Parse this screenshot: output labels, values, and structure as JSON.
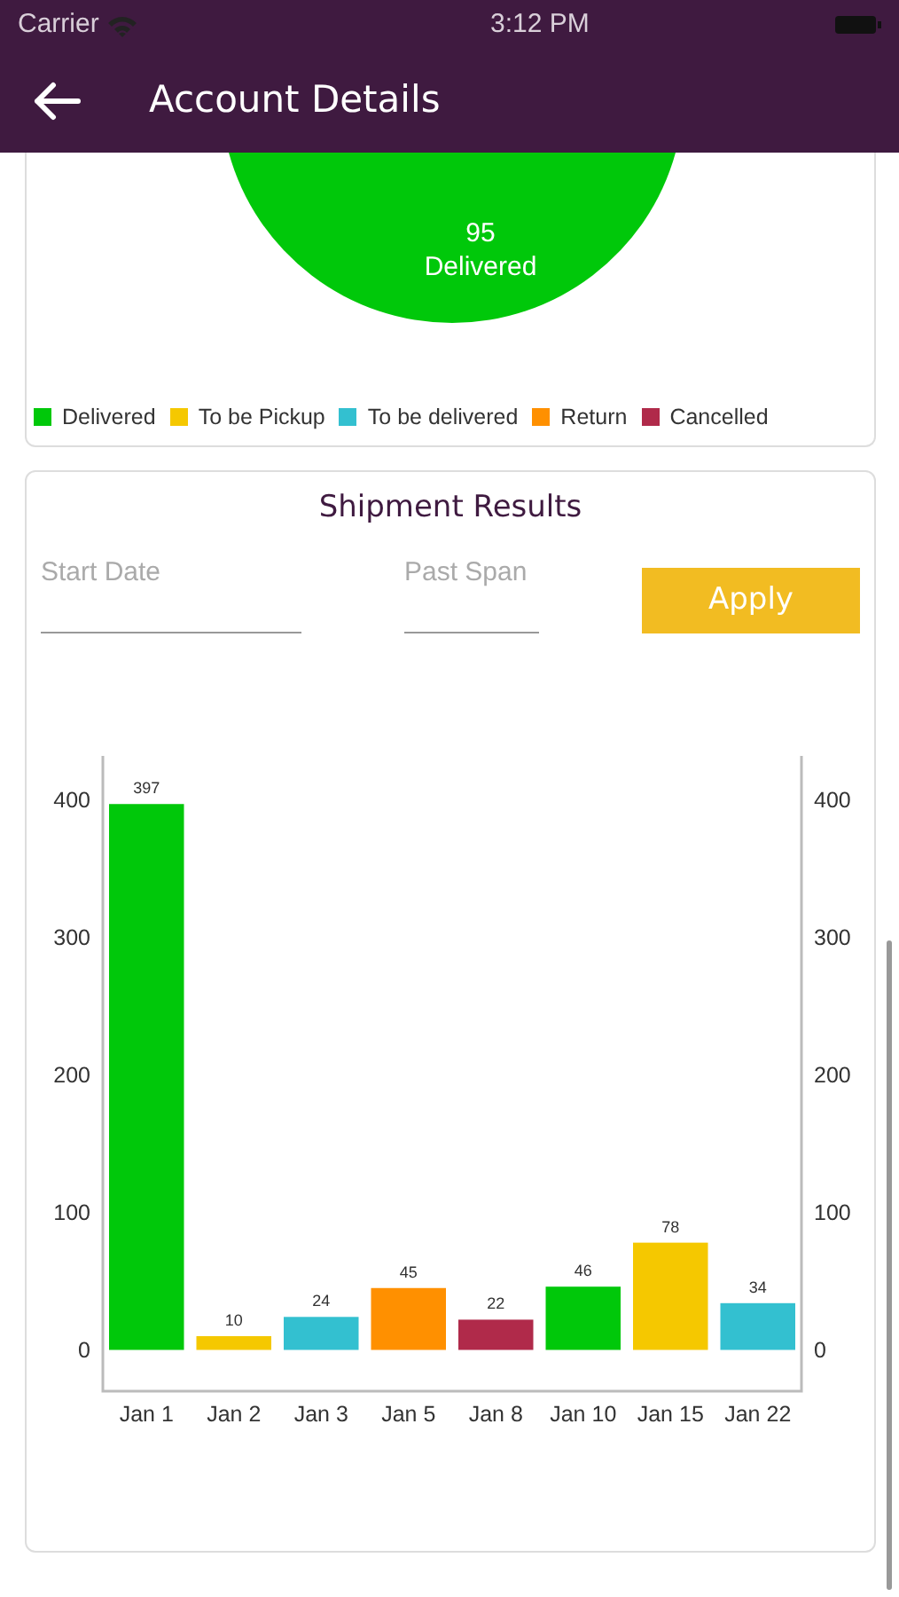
{
  "status_bar": {
    "carrier": "Carrier",
    "time": "3:12 PM"
  },
  "header": {
    "title": "Account Details"
  },
  "pie": {
    "value": "95",
    "label": "Delivered",
    "color": "#00c80a"
  },
  "legend": [
    {
      "label": "Delivered",
      "color": "#00c80a"
    },
    {
      "label": "To be Pickup",
      "color": "#f5c800"
    },
    {
      "label": "To be delivered",
      "color": "#33c0d0"
    },
    {
      "label": "Return",
      "color": "#ff9000"
    },
    {
      "label": "Cancelled",
      "color": "#b02a4a"
    }
  ],
  "shipment": {
    "title": "Shipment Results",
    "start_date": {
      "placeholder": "Start Date"
    },
    "past_span": {
      "placeholder": "Past Span"
    },
    "apply": "Apply",
    "right_axis_ticks": [
      "400",
      "300",
      "200",
      "100",
      "0"
    ],
    "chart_data": {
      "type": "bar",
      "categories": [
        "Jan 1",
        "Jan 2",
        "Jan 3",
        "Jan 5",
        "Jan 8",
        "Jan 10",
        "Jan 15",
        "Jan 22"
      ],
      "values": [
        397,
        10,
        24,
        45,
        22,
        46,
        78,
        34
      ],
      "colors": [
        "#00c80a",
        "#f5c800",
        "#33c0d0",
        "#ff9000",
        "#b02a4a",
        "#00c80a",
        "#f5c800",
        "#33c0d0"
      ],
      "ylim": [
        -30,
        432
      ],
      "yticks": [
        0,
        100,
        200,
        300,
        400
      ],
      "data_labels": true
    }
  }
}
